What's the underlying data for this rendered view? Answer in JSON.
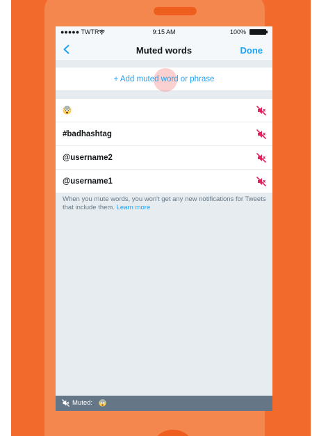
{
  "status_bar": {
    "carrier": "●●●●● TWTR",
    "time": "9:15 AM",
    "battery": "100%"
  },
  "nav": {
    "back_icon": "chevron-left-icon",
    "title": "Muted words",
    "done_label": "Done"
  },
  "add_row": {
    "label": "+ Add muted word or phrase"
  },
  "muted_words": [
    {
      "text": "",
      "icon": "astonished-emoji-icon"
    },
    {
      "text": "#badhashtag",
      "icon": ""
    },
    {
      "text": "@username2",
      "icon": ""
    },
    {
      "text": "@username1",
      "icon": ""
    }
  ],
  "info": {
    "text": "When you mute words, you won't get any new notifications for Tweets that include them. ",
    "link": "Learn more"
  },
  "toast": {
    "label": "Muted:",
    "icon": "muted-speaker-icon",
    "emoji_icon": "astonished-emoji-icon"
  },
  "colors": {
    "accent": "#1da1f2",
    "unmute_icon": "#e0245e",
    "background_orange": "#f26a2c",
    "phone_orange": "#f4874d",
    "toast_bg": "#657786"
  }
}
